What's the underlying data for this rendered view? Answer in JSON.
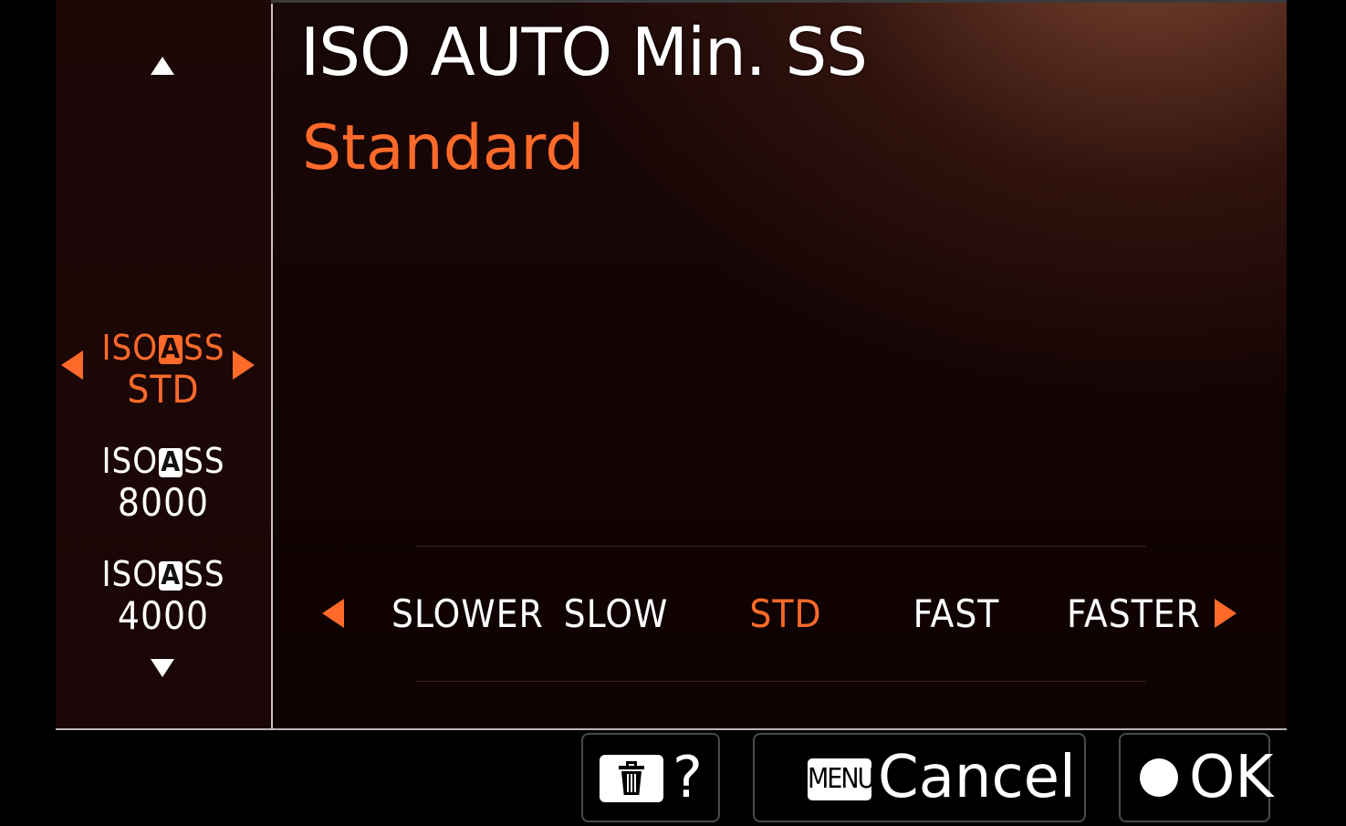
{
  "header": {
    "title": "ISO AUTO Min. SS",
    "selected_value": "Standard"
  },
  "sidebar": {
    "items": [
      {
        "prefix": "ISO",
        "badge": "A",
        "suffix": "SS",
        "value": "STD",
        "selected": true
      },
      {
        "prefix": "ISO",
        "badge": "A",
        "suffix": "SS",
        "value": "8000",
        "selected": false
      },
      {
        "prefix": "ISO",
        "badge": "A",
        "suffix": "SS",
        "value": "4000",
        "selected": false
      }
    ]
  },
  "scale": {
    "options": [
      "SLOWER",
      "SLOW",
      "STD",
      "FAST",
      "FASTER"
    ],
    "selected_index": 2
  },
  "footer": {
    "help_label": "?",
    "menu_badge": "MENU",
    "cancel_label": "Cancel",
    "ok_label": "OK"
  },
  "colors": {
    "accent": "#ff6a2a",
    "text": "#ffffff",
    "background": "#120303"
  }
}
